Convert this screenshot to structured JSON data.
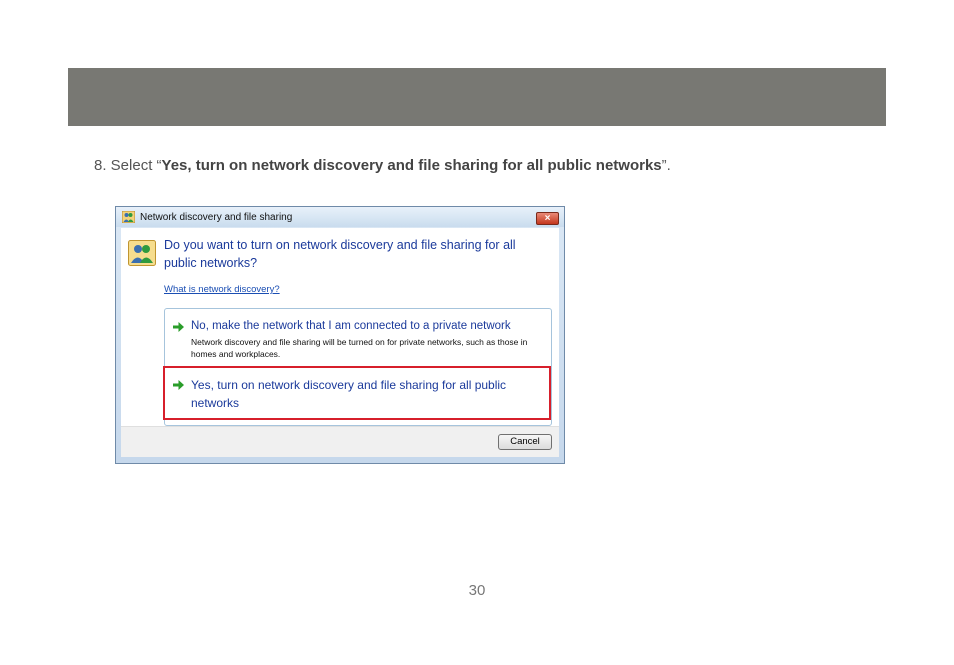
{
  "instruction": {
    "prefix": "8.  Select “",
    "bold": "Yes, turn on network discovery and file sharing for all public networks",
    "suffix": "”."
  },
  "dialog": {
    "title": "Network discovery and file sharing",
    "close_label": "×",
    "question": "Do you want to turn on network discovery and file sharing for all public networks?",
    "help_link": "What is network discovery?",
    "options": [
      {
        "title": "No, make the network that I am connected to a private network",
        "description": "Network discovery and file sharing will be turned on for private networks, such as those in homes and workplaces."
      },
      {
        "title": "Yes, turn on network discovery and file sharing for all public networks"
      }
    ],
    "cancel_label": "Cancel"
  },
  "page_number": "30",
  "colors": {
    "header_bar": "#787873",
    "highlight": "#d71f2b",
    "link_blue": "#1b3a9b",
    "arrow_green": "#2a9d2a"
  },
  "icons": {
    "dialog_icon": "network-users-icon",
    "option_arrow": "green-arrow-icon",
    "close": "close-icon"
  }
}
